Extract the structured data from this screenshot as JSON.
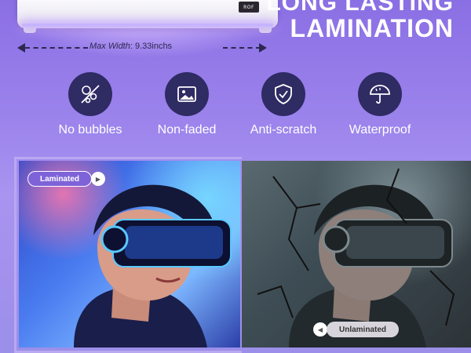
{
  "headline": {
    "line1": "LONG LASTING",
    "line2": "LAMINATION"
  },
  "device": {
    "panel_text": "ROF"
  },
  "measure": {
    "label_prefix": "Max Width",
    "label_value": ":  9.33inchs"
  },
  "features": [
    {
      "label": "No bubbles",
      "icon": "no-bubbles-icon"
    },
    {
      "label": "Non-faded",
      "icon": "image-icon"
    },
    {
      "label": "Anti-scratch",
      "icon": "shield-check-icon"
    },
    {
      "label": "Waterproof",
      "icon": "umbrella-icon"
    }
  ],
  "comparison": {
    "laminated_label": "Laminated",
    "unlaminated_label": "Unlaminated"
  },
  "colors": {
    "background": "#9c84ec",
    "icon_circle": "#2f2b63",
    "badge_laminated": "#7e63d8"
  }
}
